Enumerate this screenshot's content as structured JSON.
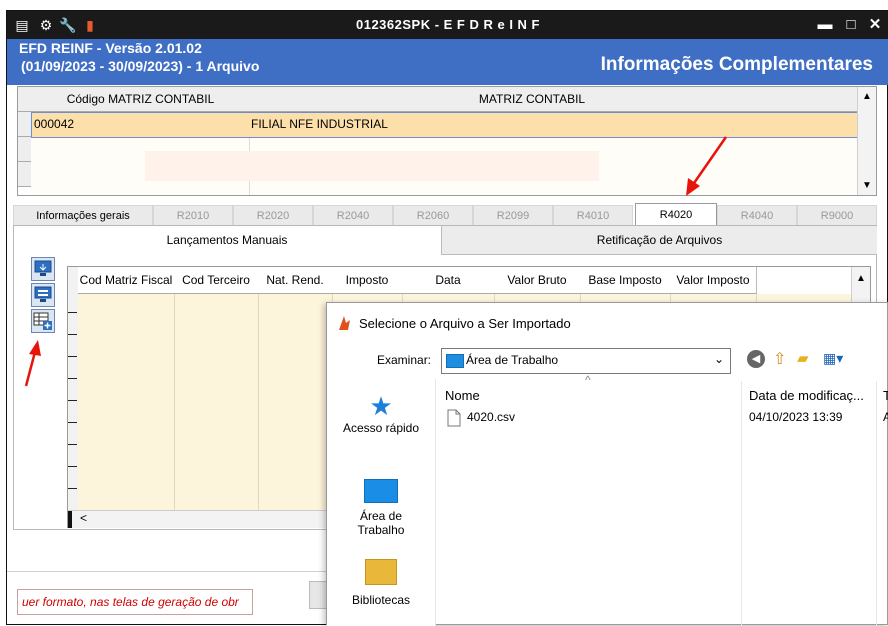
{
  "window": {
    "title": "012362SPK - E F D  R e I N F",
    "header_line1": "EFD REINF - Versão 2.01.02",
    "header_line2": "(01/09/2023 - 30/09/2023) - 1 Arquivo",
    "header_right": "Informações Complementares",
    "controls": {
      "minimize": "▬",
      "maximize": "□",
      "close": "✕"
    }
  },
  "matriz_grid": {
    "headers": [
      "Código MATRIZ CONTABIL",
      "MATRIZ CONTABIL"
    ],
    "rows": [
      {
        "codigo": "000042",
        "matriz": "FILIAL NFE INDUSTRIAL"
      }
    ]
  },
  "tabs": [
    "Informações gerais",
    "R2010",
    "R2020",
    "R2040",
    "R2060",
    "R2099",
    "R4010",
    "R4020",
    "R4040",
    "R9000"
  ],
  "active_tab": "R4020",
  "subtabs": {
    "manual": "Lançamentos Manuais",
    "retificacao": "Retificação de Arquivos"
  },
  "lancamentos_grid": {
    "headers": [
      "Cod Matriz Fiscal",
      "Cod Terceiro",
      "Nat. Rend.",
      "Imposto",
      "Data",
      "Valor Bruto",
      "Base Imposto",
      "Valor Imposto"
    ],
    "scroll_left_label": "<"
  },
  "status_text": "uer formato, nas telas de geração de obr",
  "file_dialog": {
    "title": "Selecione o Arquivo a Ser Importado",
    "look_in_label": "Examinar:",
    "look_in_value": "Área de Trabalho",
    "sidebar": {
      "quick_access": "Acesso rápido",
      "desktop": "Área de\nTrabalho",
      "libraries": "Bibliotecas"
    },
    "columns": {
      "name": "Nome",
      "modified": "Data de modificaç...",
      "type": "T"
    },
    "files": [
      {
        "name": "4020.csv",
        "modified": "04/10/2023 13:39",
        "type": "A"
      }
    ]
  },
  "colors": {
    "header_blue": "#3f6ec5",
    "row_highlight": "#fddfaa",
    "annotation_red": "#e8140c"
  }
}
